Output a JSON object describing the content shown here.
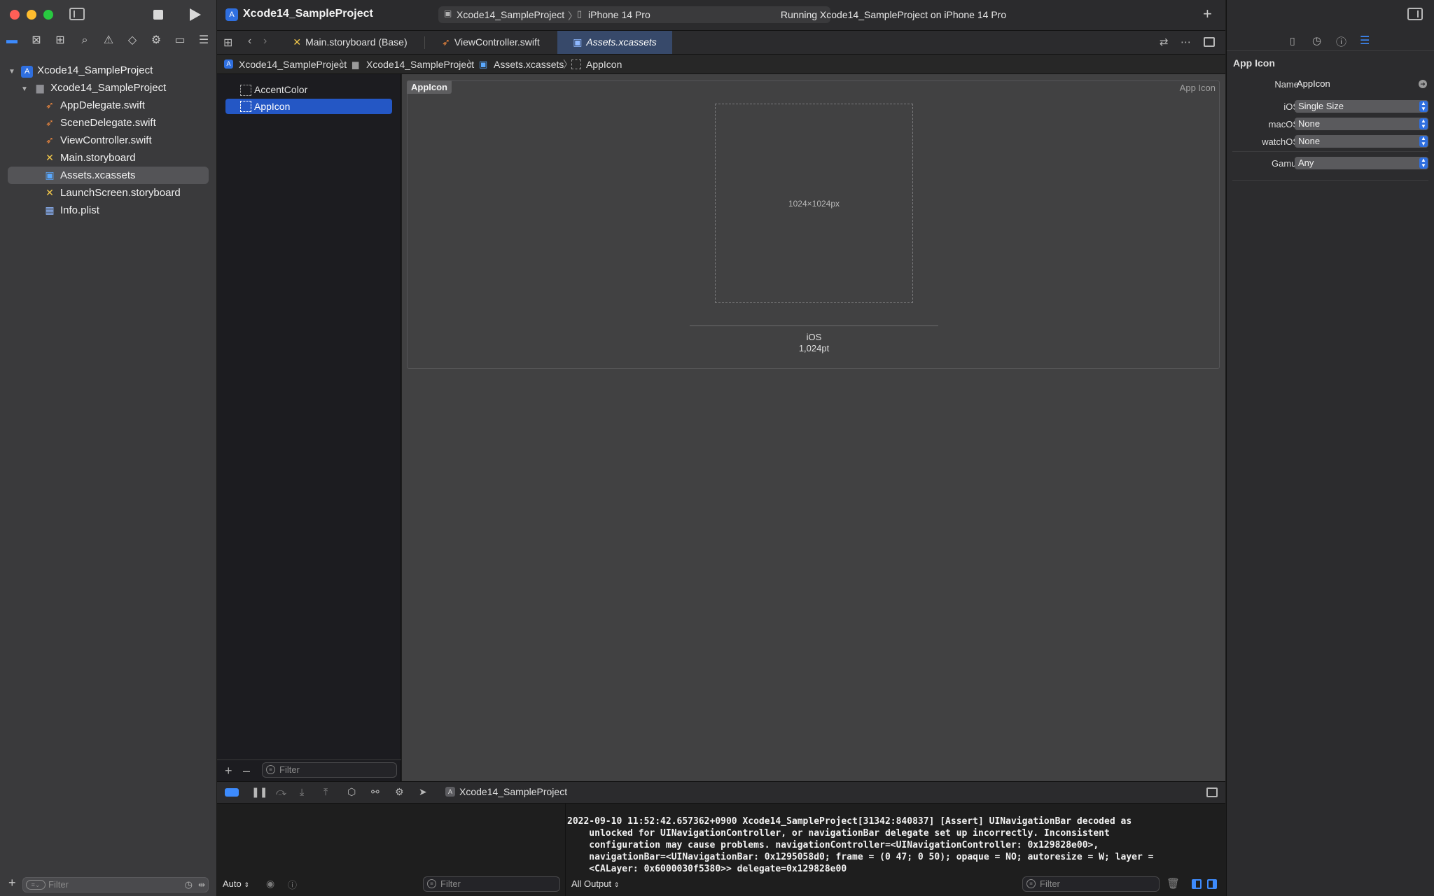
{
  "window": {
    "project_title": "Xcode14_SampleProject",
    "scheme": "Xcode14_SampleProject",
    "destination": "iPhone 14 Pro",
    "status": "Running Xcode14_SampleProject on iPhone 14 Pro"
  },
  "navigator": {
    "items": [
      {
        "label": "Xcode14_SampleProject",
        "icon": "project-icon"
      },
      {
        "label": "Xcode14_SampleProject",
        "icon": "folder-icon"
      },
      {
        "label": "AppDelegate.swift",
        "icon": "swift-icon"
      },
      {
        "label": "SceneDelegate.swift",
        "icon": "swift-icon"
      },
      {
        "label": "ViewController.swift",
        "icon": "swift-icon"
      },
      {
        "label": "Main.storyboard",
        "icon": "storyboard-icon"
      },
      {
        "label": "Assets.xcassets",
        "icon": "asset-catalog-icon"
      },
      {
        "label": "LaunchScreen.storyboard",
        "icon": "storyboard-icon"
      },
      {
        "label": "Info.plist",
        "icon": "plist-icon"
      }
    ],
    "filter_placeholder": "Filter"
  },
  "tabs": [
    {
      "label": "Main.storyboard (Base)",
      "icon": "storyboard-icon"
    },
    {
      "label": "ViewController.swift",
      "icon": "swift-icon"
    },
    {
      "label": "Assets.xcassets",
      "icon": "asset-catalog-icon"
    }
  ],
  "jumpbar": [
    "Xcode14_SampleProject",
    "Xcode14_SampleProject",
    "Assets.xcassets",
    "AppIcon"
  ],
  "asset_list": {
    "items": [
      "AccentColor",
      "AppIcon"
    ],
    "filter_placeholder": "Filter"
  },
  "asset_canvas": {
    "set_name": "AppIcon",
    "set_type": "App Icon",
    "slot_size": "1024×1024px",
    "platform": "iOS",
    "point_size": "1,024pt"
  },
  "debug_bar": {
    "process": "Xcode14_SampleProject"
  },
  "variables": {
    "mode": "Auto",
    "filter_placeholder": "Filter"
  },
  "console": {
    "lines": [
      "2022-09-10 11:52:42.657362+0900 Xcode14_SampleProject[31342:840837] [Assert] UINavigationBar decoded as",
      "    unlocked for UINavigationController, or navigationBar delegate set up incorrectly. Inconsistent",
      "    configuration may cause problems. navigationController=<UINavigationController: 0x129828e00>,",
      "    navigationBar=<UINavigationBar: 0x1295058d0; frame = (0 47; 0 50); opaque = NO; autoresize = W; layer =",
      "    <CALayer: 0x6000030f5380>> delegate=0x129828e00"
    ],
    "output_selector": "All Output",
    "filter_placeholder": "Filter"
  },
  "inspector": {
    "section_title": "App Icon",
    "name_label": "Name",
    "name_value": "AppIcon",
    "rows": [
      {
        "label": "iOS",
        "value": "Single Size"
      },
      {
        "label": "macOS",
        "value": "None"
      },
      {
        "label": "watchOS",
        "value": "None"
      },
      {
        "label": "Gamut",
        "value": "Any"
      }
    ]
  },
  "colors": {
    "accent": "#2f6fdf",
    "selection": "#2457c5",
    "active_tab": "#37496a",
    "canvas": "#414142",
    "close": "#ff5f57",
    "minimize": "#febc2e",
    "zoom": "#28c840",
    "swift": "#f0883e",
    "storyboard": "#f2c84b"
  }
}
